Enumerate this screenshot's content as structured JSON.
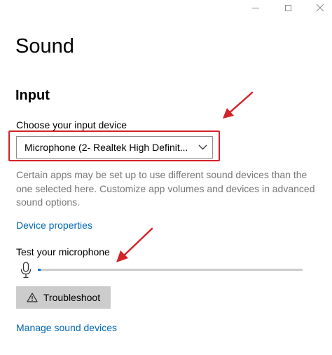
{
  "window": {
    "controls": [
      "minimize",
      "maximize",
      "close"
    ]
  },
  "page": {
    "title": "Sound"
  },
  "input": {
    "section_title": "Input",
    "device_label": "Choose your input device",
    "device_selected": "Microphone (2- Realtek High Definit...",
    "description": "Certain apps may be set up to use different sound devices than the one selected here. Customize app volumes and devices in advanced sound options.",
    "device_properties_link": "Device properties",
    "test_label": "Test your microphone",
    "mic_level_percent": 1,
    "troubleshoot_label": "Troubleshoot",
    "manage_devices_link": "Manage sound devices"
  },
  "colors": {
    "accent": "#0067b8",
    "annotation": "#d2232a",
    "muted_text": "#767676"
  },
  "icons": [
    "minimize-icon",
    "maximize-icon",
    "close-icon",
    "chevron-down-icon",
    "microphone-icon",
    "warning-icon",
    "annotation-arrow"
  ]
}
